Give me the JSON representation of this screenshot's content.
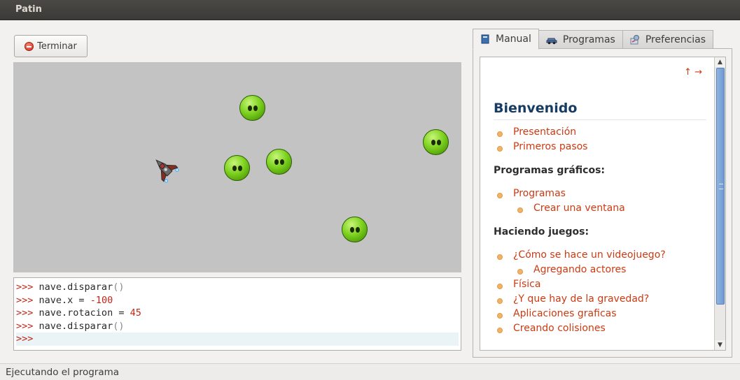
{
  "window": {
    "title": "Patin"
  },
  "toolbar": {
    "stop_label": "Terminar",
    "stop_icon": "stop-icon"
  },
  "console": {
    "prompt": ">>>",
    "lines": [
      {
        "code": "nave.disparar",
        "suffix": "()"
      },
      {
        "code": "nave.x = ",
        "value": "-100"
      },
      {
        "code": "nave.rotacion = ",
        "value": "45"
      },
      {
        "code": "nave.disparar",
        "suffix": "()"
      }
    ]
  },
  "tabs": [
    {
      "label": "Manual",
      "icon": "book-icon",
      "active": true
    },
    {
      "label": "Programas",
      "icon": "car-icon",
      "active": false
    },
    {
      "label": "Preferencias",
      "icon": "preferences-icon",
      "active": false
    }
  ],
  "help": {
    "nav_up": "↑",
    "nav_next": "→",
    "title": "Bienvenido",
    "links_intro": [
      "Presentación",
      "Primeros pasos"
    ],
    "section_graphics": "Programas gráficos:",
    "link_programas": "Programas",
    "link_crear_ventana": "Crear una ventana",
    "section_games": "Haciendo juegos:",
    "link_videojuego": "¿Cómo se hace un videojuego?",
    "link_actores": "Agregando actores",
    "link_fisica": "Física",
    "link_gravedad": "¿Y que hay de la gravedad?",
    "link_aplicaciones": "Aplicaciones graficas",
    "link_colisiones": "Creando colisiones"
  },
  "colors": {
    "accent_link": "#cc3a12",
    "heading": "#173c64",
    "canvas_bg": "#c3c3c3",
    "alien_green": "#7ed321"
  },
  "status": {
    "text": "Ejecutando el programa"
  }
}
